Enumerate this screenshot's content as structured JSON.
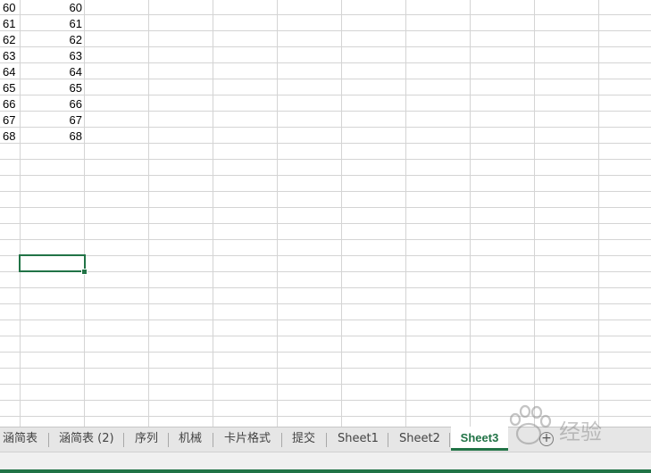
{
  "sheet": {
    "col_a": [
      "60",
      "61",
      "62",
      "63",
      "64",
      "65",
      "66",
      "67",
      "68"
    ],
    "col_b": [
      "60",
      "61",
      "62",
      "63",
      "64",
      "65",
      "66",
      "67",
      "68"
    ]
  },
  "tabs": [
    {
      "label": "涵简表"
    },
    {
      "label": "涵简表 (2)"
    },
    {
      "label": "序列"
    },
    {
      "label": "机械"
    },
    {
      "label": "卡片格式"
    },
    {
      "label": "提交"
    },
    {
      "label": "Sheet1"
    },
    {
      "label": "Sheet2"
    },
    {
      "label": "Sheet3",
      "active": true
    }
  ],
  "add_sheet_icon": "plus-circle-icon",
  "watermark": {
    "text": "经验",
    "icon": "baidu-paw-icon"
  },
  "colors": {
    "accent": "#217346",
    "gridline": "#d4d4d4",
    "tabbar": "#e6e6e6"
  }
}
